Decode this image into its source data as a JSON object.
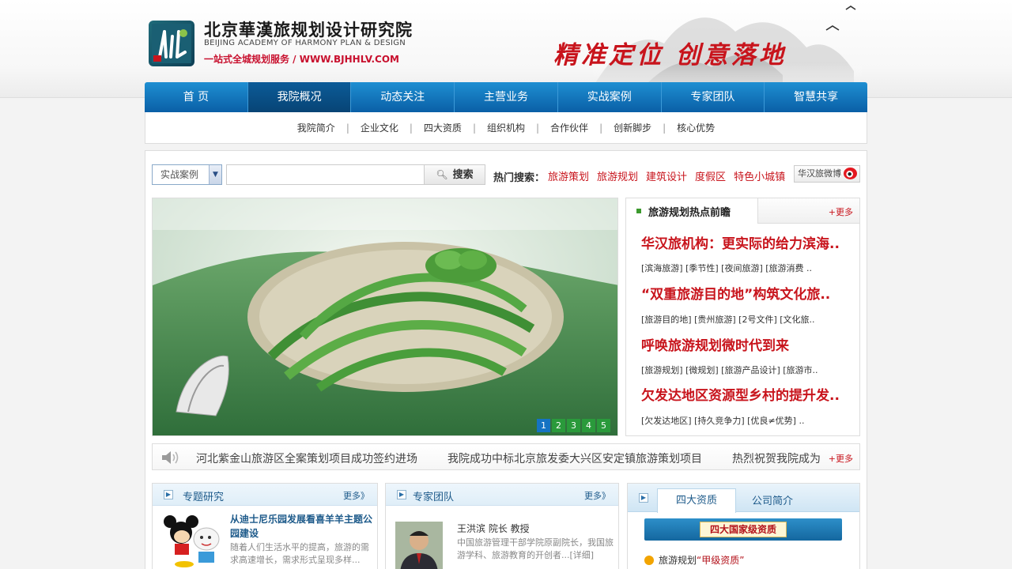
{
  "header": {
    "logo_cn": "北京華漢旅规划设计研究院",
    "logo_en": "BEIJING ACADEMY OF HARMONY PLAN & DESIGN",
    "logo_tagline": "一站式全城规划服务 / WWW.BJHHLV.COM",
    "slogan": "精准定位 创意落地"
  },
  "nav": {
    "items": [
      "首 页",
      "我院概况",
      "动态关注",
      "主营业务",
      "实战案例",
      "专家团队",
      "智慧共享"
    ],
    "active_index": 1
  },
  "subnav": {
    "items": [
      "我院简介",
      "企业文化",
      "四大资质",
      "组织机构",
      "合作伙伴",
      "创新脚步",
      "核心优势"
    ]
  },
  "search": {
    "category": "实战案例",
    "input_value": "",
    "button_label": "搜索",
    "hot_label": "热门搜索：",
    "hot_links": [
      "旅游策划",
      "旅游规划",
      "建筑设计",
      "度假区",
      "特色小城镇"
    ],
    "weibo_label": "华汉旅微博"
  },
  "banner": {
    "pages": [
      "1",
      "2",
      "3",
      "4",
      "5"
    ],
    "active_page": 0
  },
  "hot_panel": {
    "title": "旅游规划热点前瞻",
    "more": "+更多",
    "news": [
      {
        "title": "华汉旅机构：更实际的给力滨海..",
        "tags": "[滨海旅游] [季节性] [夜间旅游] [旅游消费 .."
      },
      {
        "title": "“双重旅游目的地”构筑文化旅..",
        "tags": "[旅游目的地] [贵州旅游] [2号文件] [文化旅.."
      },
      {
        "title": "呼唤旅游规划微时代到来",
        "tags": "[旅游规划] [微规划] [旅游产品设计] [旅游市.."
      },
      {
        "title": "欠发达地区资源型乡村的提升发..",
        "tags": "[欠发达地区] [持久竞争力] [优良≠优势] .."
      }
    ]
  },
  "ticker": {
    "items": [
      "河北紫金山旅游区全案策划项目成功签约进场",
      "我院成功中标北京旅发委大兴区安定镇旅游策划项目",
      "热烈祝贺我院成为"
    ],
    "more": "+更多"
  },
  "boxes": {
    "topics": {
      "title": "专题研究",
      "more": "更多》",
      "article_title": "从迪士尼乐园发展看喜羊羊主题公园建设",
      "article_text_1": "随着人们生活水平的提高，旅游的需",
      "article_text_2": "求高速增长，需求形式呈现多样..."
    },
    "experts": {
      "title": "专家团队",
      "more": "更多》",
      "name_line": "王洪滨  院长 教授",
      "desc_1": "中国旅游管理干部学院原副院长，我国旅",
      "desc_2": "游学科、旅游教育的开创者...[详细]"
    },
    "qualifications": {
      "tab_active": "四大资质",
      "tab_other": "公司简介",
      "ribbon": "四大国家级资质",
      "item_prefix": "旅游规划",
      "item_quote": "“甲级资质”"
    }
  },
  "colors": {
    "brand_blue": "#0a5fa6",
    "accent_red": "#c8141c",
    "pager_green": "#2a9a3b"
  }
}
